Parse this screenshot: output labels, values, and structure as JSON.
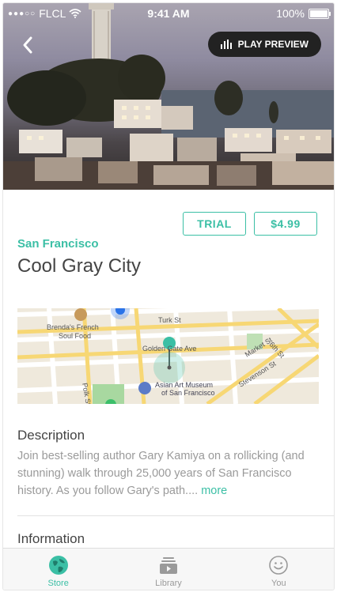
{
  "status_bar": {
    "carrier": "FLCL",
    "signal_dots": "●●●○○",
    "time": "9:41 AM",
    "battery": "100%"
  },
  "hero": {
    "play_preview_label": "PLAY PREVIEW"
  },
  "purchase": {
    "trial_label": "TRIAL",
    "price_label": "$4.99"
  },
  "tour": {
    "city": "San Francisco",
    "title": "Cool Gray City"
  },
  "map": {
    "labels": {
      "restaurant": "Brenda's French",
      "restaurant2": "Soul Food",
      "turk": "Turk St",
      "golden_gate": "Golden Gate Ave",
      "polk": "Polk St",
      "museum": "Asian Art Museum",
      "museum2": "of San Francisco",
      "market": "Market St",
      "sixth": "6th St",
      "stevenson": "Stevenson St"
    }
  },
  "description": {
    "heading": "Description",
    "text": "Join best-selling author Gary Kamiya on a rollicking (and stunning) walk through 25,000 years of San Francisco history. As you follow Gary's path....",
    "more_label": "more"
  },
  "information": {
    "heading": "Information"
  },
  "tabbar": {
    "tabs": [
      {
        "label": "Store",
        "icon": "globe-icon",
        "active": true
      },
      {
        "label": "Library",
        "icon": "library-icon",
        "active": false
      },
      {
        "label": "You",
        "icon": "smiley-icon",
        "active": false
      }
    ]
  },
  "colors": {
    "accent": "#3bbfa5",
    "text": "#444444",
    "muted": "#9a9a9a"
  }
}
